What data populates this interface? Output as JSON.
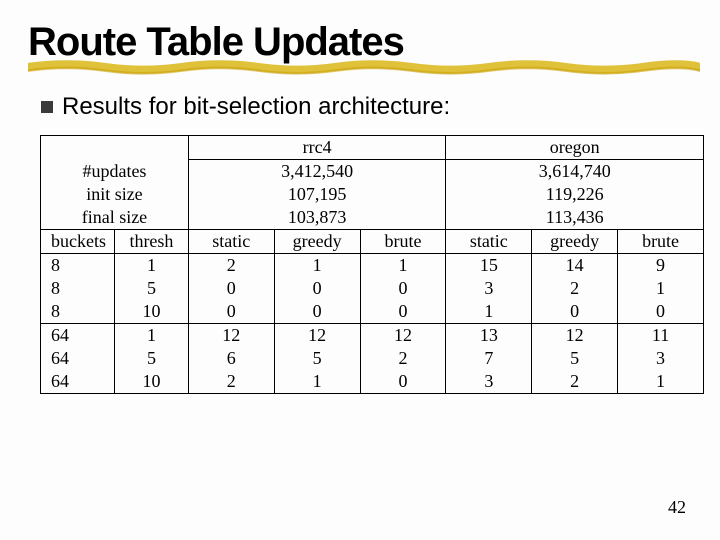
{
  "title": "Route Table Updates",
  "bullet": "Results for bit-selection architecture:",
  "page_number": "42",
  "table": {
    "datasets": [
      "rrc4",
      "oregon"
    ],
    "header_rows": [
      {
        "label": "#updates",
        "rrc4": "3,412,540",
        "oregon": "3,614,740"
      },
      {
        "label": "init size",
        "rrc4": "107,195",
        "oregon": "119,226"
      },
      {
        "label": "final size",
        "rrc4": "103,873",
        "oregon": "113,436"
      }
    ],
    "col_headers": {
      "c1": "buckets",
      "c2": "thresh",
      "c3": "static",
      "c4": "greedy",
      "c5": "brute",
      "c6": "static",
      "c7": "greedy",
      "c8": "brute"
    },
    "rows": [
      {
        "buckets": "8",
        "thresh": "1",
        "r_static": "2",
        "r_greedy": "1",
        "r_brute": "1",
        "o_static": "15",
        "o_greedy": "14",
        "o_brute": "9"
      },
      {
        "buckets": "8",
        "thresh": "5",
        "r_static": "0",
        "r_greedy": "0",
        "r_brute": "0",
        "o_static": "3",
        "o_greedy": "2",
        "o_brute": "1"
      },
      {
        "buckets": "8",
        "thresh": "10",
        "r_static": "0",
        "r_greedy": "0",
        "r_brute": "0",
        "o_static": "1",
        "o_greedy": "0",
        "o_brute": "0"
      },
      {
        "buckets": "64",
        "thresh": "1",
        "r_static": "12",
        "r_greedy": "12",
        "r_brute": "12",
        "o_static": "13",
        "o_greedy": "12",
        "o_brute": "11"
      },
      {
        "buckets": "64",
        "thresh": "5",
        "r_static": "6",
        "r_greedy": "5",
        "r_brute": "2",
        "o_static": "7",
        "o_greedy": "5",
        "o_brute": "3"
      },
      {
        "buckets": "64",
        "thresh": "10",
        "r_static": "2",
        "r_greedy": "1",
        "r_brute": "0",
        "o_static": "3",
        "o_greedy": "2",
        "o_brute": "1"
      }
    ]
  }
}
